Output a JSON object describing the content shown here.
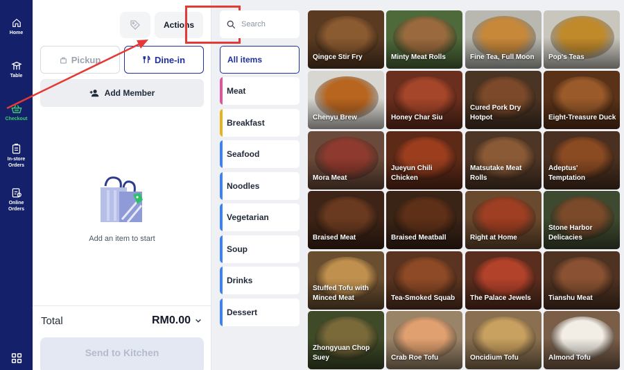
{
  "nav": {
    "home": "Home",
    "table": "Table",
    "checkout": "Checkout",
    "instore_line1": "In-store",
    "instore_line2": "Orders",
    "online_line1": "Online",
    "online_line2": "Orders"
  },
  "order": {
    "actions_label": "Actions",
    "pickup_label": "Pickup",
    "dinein_label": "Dine-in",
    "add_member_label": "Add Member",
    "empty_text": "Add an item to start",
    "total_label": "Total",
    "total_amount": "RM0.00",
    "send_label": "Send to Kitchen"
  },
  "search": {
    "placeholder": "Search"
  },
  "categories": [
    {
      "label": "All items",
      "color": "#1e2f9e"
    },
    {
      "label": "Meat",
      "color": "#e0559a"
    },
    {
      "label": "Breakfast",
      "color": "#e8b21f"
    },
    {
      "label": "Seafood",
      "color": "#3b82f6"
    },
    {
      "label": "Noodles",
      "color": "#3b82f6"
    },
    {
      "label": "Vegetarian",
      "color": "#3b82f6"
    },
    {
      "label": "Soup",
      "color": "#3b82f6"
    },
    {
      "label": "Drinks",
      "color": "#3b82f6"
    },
    {
      "label": "Dessert",
      "color": "#3b82f6"
    }
  ],
  "menu_items": [
    {
      "name": "Qingce Stir Fry",
      "bg": "#5a3b22",
      "accent": "#8a5a30"
    },
    {
      "name": "Minty Meat Rolls",
      "bg": "#4e6a3a",
      "accent": "#9a6a3e"
    },
    {
      "name": "Fine Tea, Full Moon",
      "bg": "#b8b8b0",
      "accent": "#c7883a"
    },
    {
      "name": "Pop's Teas",
      "bg": "#c9c6bd",
      "accent": "#c08a2a"
    },
    {
      "name": "Chenyu Brew",
      "bg": "#d8d6d0",
      "accent": "#b8651f"
    },
    {
      "name": "Honey Char Siu",
      "bg": "#6a2f1e",
      "accent": "#a5462a"
    },
    {
      "name": "Cured Pork Dry Hotpot",
      "bg": "#4a3424",
      "accent": "#7c4a2a"
    },
    {
      "name": "Eight-Treasure Duck",
      "bg": "#5a3218",
      "accent": "#9a5a2a"
    },
    {
      "name": "Mora Meat",
      "bg": "#6a4a3a",
      "accent": "#8e3a2e"
    },
    {
      "name": "Jueyun Chili Chicken",
      "bg": "#5e2a18",
      "accent": "#9c3e1e"
    },
    {
      "name": "Matsutake Meat Rolls",
      "bg": "#4e3626",
      "accent": "#8a5a36"
    },
    {
      "name": "Adeptus' Temptation",
      "bg": "#4a3020",
      "accent": "#8a4a22"
    },
    {
      "name": "Braised Meat",
      "bg": "#3e2416",
      "accent": "#6a3a20"
    },
    {
      "name": "Braised Meatball",
      "bg": "#3a2416",
      "accent": "#5e3018"
    },
    {
      "name": "Right at Home",
      "bg": "#6a4a2e",
      "accent": "#9e3e22"
    },
    {
      "name": "Stone Harbor Delicacies",
      "bg": "#3e4a30",
      "accent": "#7a4a2a"
    },
    {
      "name": "Stuffed Tofu with Minced Meat",
      "bg": "#6a4e30",
      "accent": "#c0904e"
    },
    {
      "name": "Tea-Smoked Squab",
      "bg": "#5a3420",
      "accent": "#8e4a26"
    },
    {
      "name": "The Palace Jewels",
      "bg": "#5a2e1e",
      "accent": "#b2422a"
    },
    {
      "name": "Tianshu Meat",
      "bg": "#4e3222",
      "accent": "#8a5232"
    },
    {
      "name": "Zhongyuan Chop Suey",
      "bg": "#3e4a28",
      "accent": "#7a6a3a"
    },
    {
      "name": "Crab Roe Tofu",
      "bg": "#9a8468",
      "accent": "#e0a070"
    },
    {
      "name": "Oncidium Tofu",
      "bg": "#8a7050",
      "accent": "#c8a060"
    },
    {
      "name": "Almond Tofu",
      "bg": "#7a5e48",
      "accent": "#f2eee6"
    }
  ],
  "colors": {
    "nav_bg": "#14206a",
    "brand": "#1e2f9e",
    "checkout_active": "#3bd36b",
    "annotation": "#e53935"
  }
}
